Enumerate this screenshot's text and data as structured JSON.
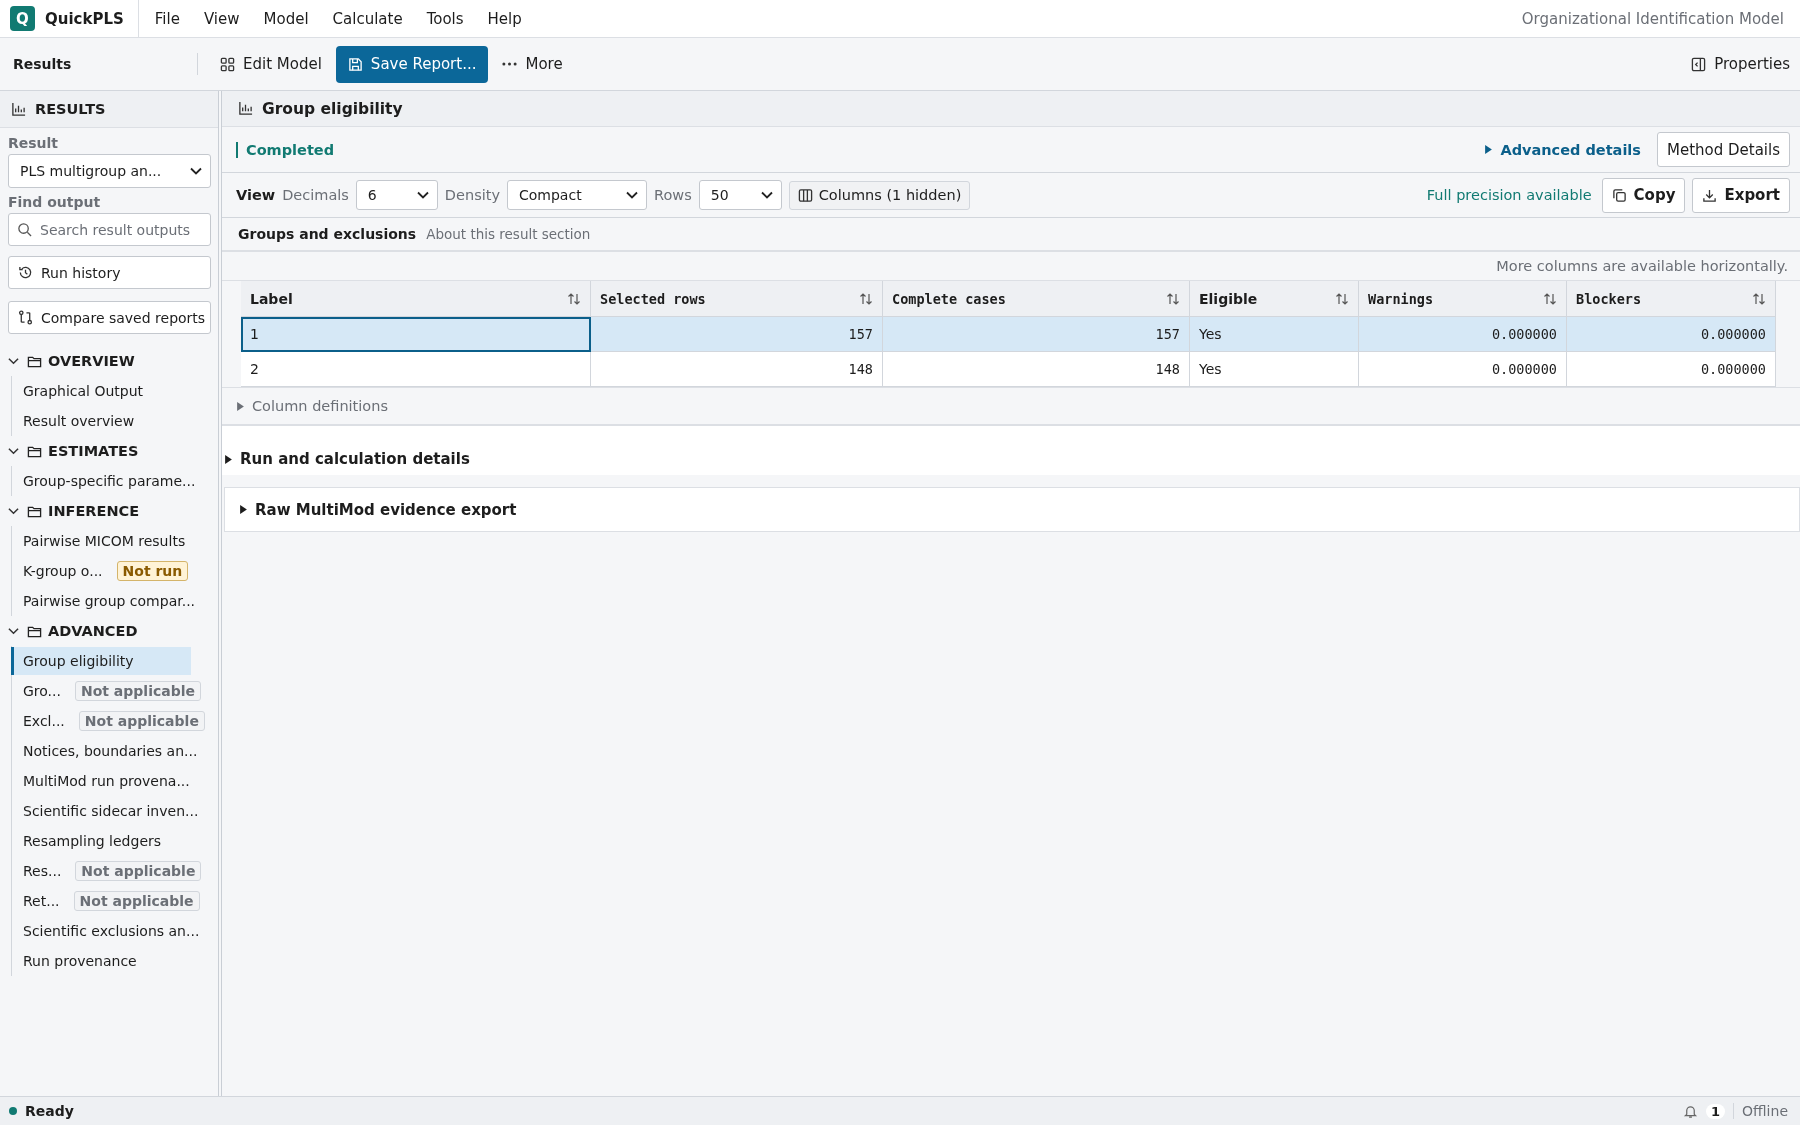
{
  "app": {
    "logo": "Q",
    "name": "QuickPLS",
    "model_title": "Organizational Identification Model"
  },
  "menu": [
    "File",
    "View",
    "Model",
    "Calculate",
    "Tools",
    "Help"
  ],
  "toolbar": {
    "title": "Results",
    "edit": "Edit Model",
    "save": "Save Report...",
    "more": "More",
    "properties": "Properties"
  },
  "sidebar": {
    "title": "RESULTS",
    "result_label": "Result",
    "result_value": "PLS multigroup an...",
    "find_label": "Find output",
    "search_placeholder": "Search result outputs",
    "run_history": "Run history",
    "compare": "Compare saved reports",
    "sections": [
      {
        "title": "OVERVIEW",
        "expanded": true,
        "items": [
          {
            "label": "Graphical Output",
            "selected": false
          },
          {
            "label": "Result overview",
            "selected": false
          }
        ]
      },
      {
        "title": "ESTIMATES",
        "expanded": true,
        "items": [
          {
            "label": "Group-specific parame...",
            "selected": false
          }
        ]
      },
      {
        "title": "INFERENCE",
        "expanded": true,
        "items": [
          {
            "label": "Pairwise MICOM results",
            "selected": false
          },
          {
            "label": "K-group o...",
            "selected": false,
            "badge": {
              "text": "Not run",
              "kind": "warning"
            }
          },
          {
            "label": "Pairwise group compar...",
            "selected": false
          }
        ]
      },
      {
        "title": "ADVANCED",
        "expanded": true,
        "items": [
          {
            "label": "Group eligibility",
            "selected": true
          },
          {
            "label": "Gro...",
            "selected": false,
            "badge": {
              "text": "Not applicable",
              "kind": "muted"
            }
          },
          {
            "label": "Excl...",
            "selected": false,
            "badge": {
              "text": "Not applicable",
              "kind": "muted"
            }
          },
          {
            "label": "Notices, boundaries an...",
            "selected": false
          },
          {
            "label": "MultiMod run provena...",
            "selected": false
          },
          {
            "label": "Scientific sidecar inven...",
            "selected": false
          },
          {
            "label": "Resampling ledgers",
            "selected": false
          },
          {
            "label": "Res...",
            "selected": false,
            "badge": {
              "text": "Not applicable",
              "kind": "muted"
            }
          },
          {
            "label": "Ret...",
            "selected": false,
            "badge": {
              "text": "Not applicable",
              "kind": "muted"
            }
          },
          {
            "label": "Scientific exclusions an...",
            "selected": false
          },
          {
            "label": "Run provenance",
            "selected": false
          }
        ]
      }
    ]
  },
  "main": {
    "title": "Group eligibility",
    "status": "Completed",
    "advanced": {
      "label": "Advanced details",
      "expanded": false
    },
    "method_button": "Method Details",
    "view": {
      "label": "View",
      "decimals_label": "Decimals",
      "decimals": "6",
      "density_label": "Density",
      "density": "Compact",
      "rows_label": "Rows",
      "rows": "50",
      "columns_button": "Columns (1 hidden)",
      "precision_note": "Full precision available",
      "copy": "Copy",
      "export": "Export"
    },
    "section_title": "Groups and exclusions",
    "section_link": "About this result section",
    "scroll_note": "More columns are available horizontally.",
    "table": {
      "columns": [
        {
          "label": "Label",
          "kind": "text"
        },
        {
          "label": "Selected rows",
          "kind": "number"
        },
        {
          "label": "Complete cases",
          "kind": "number"
        },
        {
          "label": "Eligible",
          "kind": "text"
        },
        {
          "label": "Warnings",
          "kind": "number"
        },
        {
          "label": "Blockers",
          "kind": "number"
        }
      ],
      "rows": [
        {
          "selected": true,
          "focused": true,
          "cells": [
            "1",
            "157",
            "157",
            "Yes",
            "0.000000",
            "0.000000"
          ]
        },
        {
          "selected": false,
          "focused": false,
          "cells": [
            "2",
            "148",
            "148",
            "Yes",
            "0.000000",
            "0.000000"
          ]
        }
      ]
    },
    "column_definitions": {
      "label": "Column definitions",
      "expanded": false
    },
    "details": [
      {
        "label": "Run and calculation details",
        "expanded": false,
        "kind": "plain"
      },
      {
        "label": "Raw MultiMod evidence export",
        "expanded": false,
        "kind": "boxed"
      }
    ]
  },
  "status_bar": {
    "status": "Ready",
    "notifications": "1",
    "connection": "Offline"
  }
}
